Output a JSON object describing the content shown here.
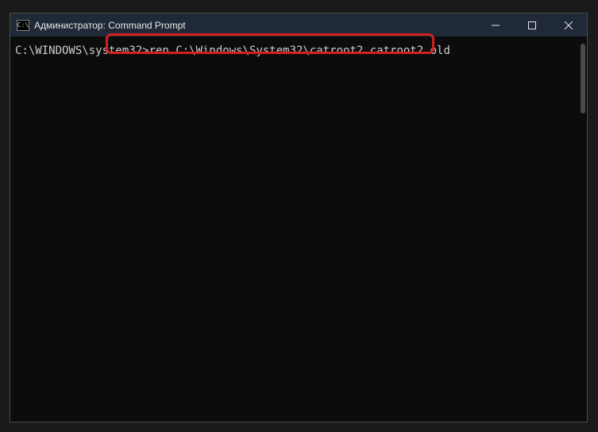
{
  "window": {
    "title": "Администратор: Command Prompt",
    "icon_label": "C:\\"
  },
  "terminal": {
    "prompt": "C:\\WINDOWS\\system32>",
    "command": "ren C:\\Windows\\System32\\catroot2 catroot2.old"
  },
  "controls": {
    "minimize": "minimize",
    "maximize": "maximize",
    "close": "close"
  }
}
